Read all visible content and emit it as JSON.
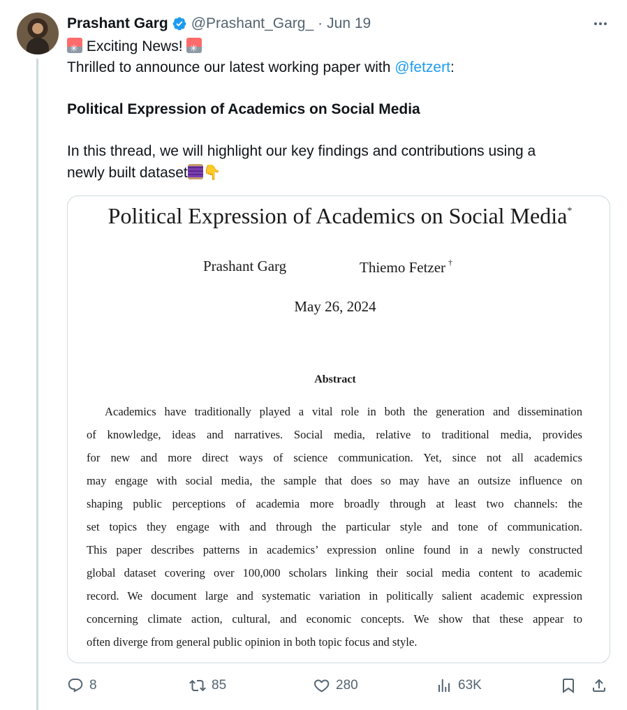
{
  "tweet": {
    "author_name": "Prashant Garg",
    "handle": "@Prashant_Garg_",
    "separator": "·",
    "date": "Jun 19",
    "line1_text": " Exciting News! ",
    "line2_prefix": "Thrilled to announce our latest working paper with ",
    "mention": "@fetzert",
    "line2_suffix": ":",
    "paper_title_line": "Political Expression of Academics on Social Media",
    "thread_line1": "In this thread, we will highlight our key findings and contributions using a",
    "thread_line2": "newly built dataset"
  },
  "paper": {
    "title": "Political Expression of Academics on Social Media",
    "title_mark": "*",
    "author1": "Prashant Garg",
    "author2": "Thiemo Fetzer",
    "author2_mark": "†",
    "date": "May 26, 2024",
    "abstract_heading": "Abstract",
    "abstract_lines": [
      "Academics have traditionally played a vital role in both the generation and dissemination",
      "of knowledge, ideas and narratives. Social media, relative to traditional media, provides",
      "for new and more direct ways of science communication. Yet, since not all academics",
      "may engage with social media, the sample that does so may have an outsize influence on",
      "shaping public perceptions of academia more broadly through at least two channels: the",
      "set topics they engage with and through the particular style and tone of communication.",
      "This paper describes patterns in academics’ expression online found in a newly constructed",
      "global dataset covering over 100,000 scholars linking their social media content to academic",
      "record. We document large and systematic variation in politically salient academic expression",
      "concerning climate action, cultural, and economic concepts. We show that these appear to",
      "often diverge from general public opinion in both topic focus and style."
    ]
  },
  "actions": {
    "replies": "8",
    "reposts": "85",
    "likes": "280",
    "views": "63K"
  },
  "icons": {
    "verified": "verified-badge-icon",
    "more": "more-icon",
    "reply": "reply-icon",
    "repost": "repost-icon",
    "like": "heart-icon",
    "views": "views-icon",
    "bookmark": "bookmark-icon",
    "share": "share-icon",
    "siren_emoji": "siren-emoji-icon",
    "thread_emoji": "thread-emoji-icon",
    "pointing_down_emoji": "pointing-down-emoji-icon"
  },
  "colors": {
    "accent": "#1d9bf0",
    "text": "#0f1419",
    "muted": "#536471",
    "border": "#cfd9de"
  }
}
